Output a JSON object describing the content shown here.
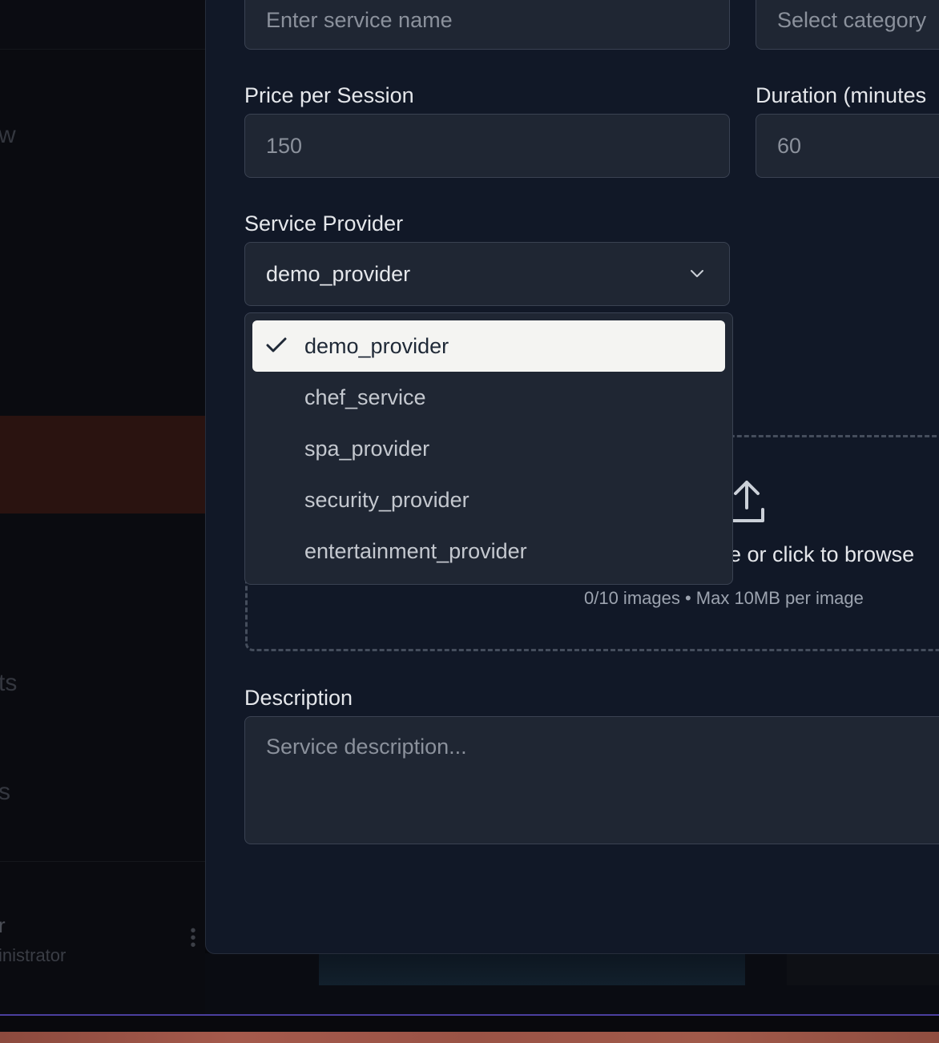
{
  "background": {
    "sidebar_fragments": [
      "w",
      "ts",
      "s"
    ],
    "user_name_fragment": "r",
    "user_role_fragment": "inistrator",
    "kebab": "⋮"
  },
  "form": {
    "service_name": {
      "placeholder": "Enter service name"
    },
    "category": {
      "placeholder": "Select category"
    },
    "price": {
      "label": "Price per Session",
      "placeholder": "150"
    },
    "duration": {
      "label": "Duration (minutes",
      "placeholder": "60"
    },
    "provider": {
      "label": "Service Provider",
      "value": "demo_provider"
    },
    "upload": {
      "text": "e or click to browse",
      "sub": "0/10 images • Max 10MB per image"
    },
    "description": {
      "label": "Description",
      "placeholder": "Service description..."
    }
  },
  "dropdown": {
    "options": [
      {
        "label": "demo_provider",
        "selected": true
      },
      {
        "label": "chef_service",
        "selected": false
      },
      {
        "label": "spa_provider",
        "selected": false
      },
      {
        "label": "security_provider",
        "selected": false
      },
      {
        "label": "entertainment_provider",
        "selected": false
      }
    ]
  },
  "icons": [
    "check-icon",
    "chevron-down-icon",
    "upload-icon",
    "kebab-menu-icon"
  ],
  "colors": {
    "modal_bg": "#111827",
    "field_bg": "#1f2633",
    "selected_bg": "#f4f4f2",
    "active_nav": "#2a1310"
  }
}
